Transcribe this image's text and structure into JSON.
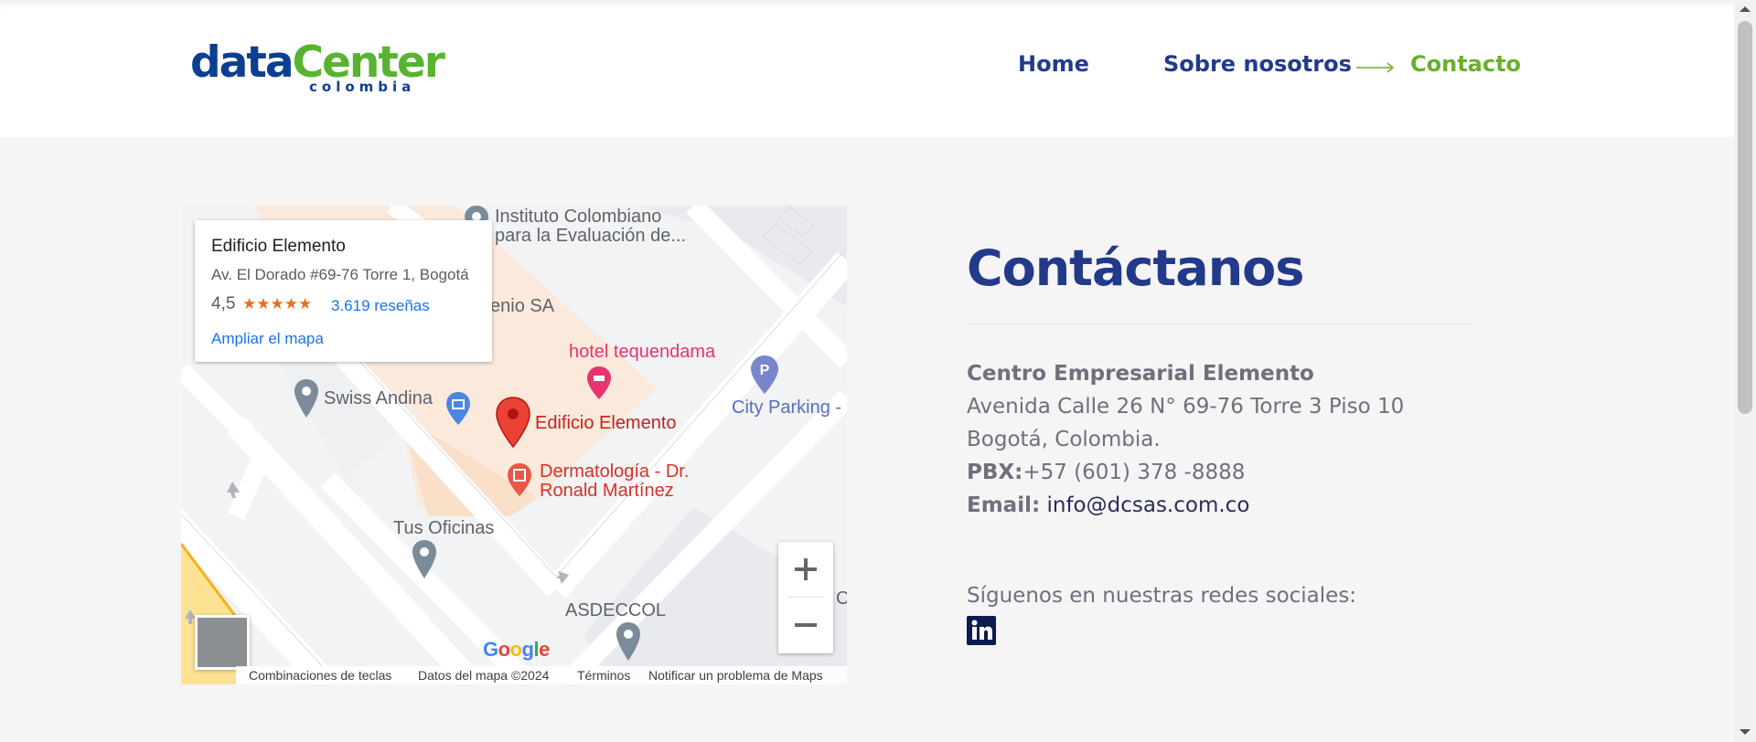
{
  "header": {
    "logo_text_main_1": "data",
    "logo_text_main_2": "Center",
    "logo_text_sub": "colombia",
    "nav": {
      "home": "Home",
      "about": "Sobre nosotros",
      "contact": "Contacto"
    }
  },
  "map": {
    "card": {
      "name": "Edificio Elemento",
      "address": "Av. El Dorado #69-76 Torre 1, Bogotá",
      "rating": "4,5",
      "stars": "★★★★★",
      "reviews": "3.619 reseñas",
      "enlarge": "Ampliar el mapa"
    },
    "labels": {
      "instituto": "Instituto Colombiano",
      "instituto2": "para la Evaluación de...",
      "enio": "enio SA",
      "hotel": "hotel tequendama",
      "swiss": "Swiss Andina",
      "edificio": "Edificio Elemento",
      "derma1": "Dermatología - Dr.",
      "derma2": "Ronald Martínez",
      "city_parking": "City Parking -",
      "tus_oficinas": "Tus Oficinas",
      "asdeccol": "ASDECCOL",
      "c_label": "C"
    },
    "google": "Google",
    "footer": {
      "shortcuts": "Combinaciones de teclas",
      "data": "Datos del mapa ©2024",
      "terms": "Términos",
      "report": "Notificar un problema de Maps"
    },
    "zoom_in": "+",
    "zoom_out": "−"
  },
  "contact": {
    "title": "Contáctanos",
    "company": "Centro Empresarial Elemento",
    "address_line1": "Avenida Calle 26 N° 69-76 Torre 3 Piso 10",
    "address_line2": "Bogotá, Colombia.",
    "pbx_label": "PBX:",
    "pbx_value": "+57 (601) 378 -8888",
    "email_label": "Email:",
    "email_value": "info@dcsas.com.co",
    "social_title": "Síguenos en nuestras redes sociales:",
    "linkedin": "in"
  },
  "colors": {
    "brand_blue": "#233a8b",
    "brand_green": "#6aaf2e",
    "map_link": "#1a73e8"
  }
}
